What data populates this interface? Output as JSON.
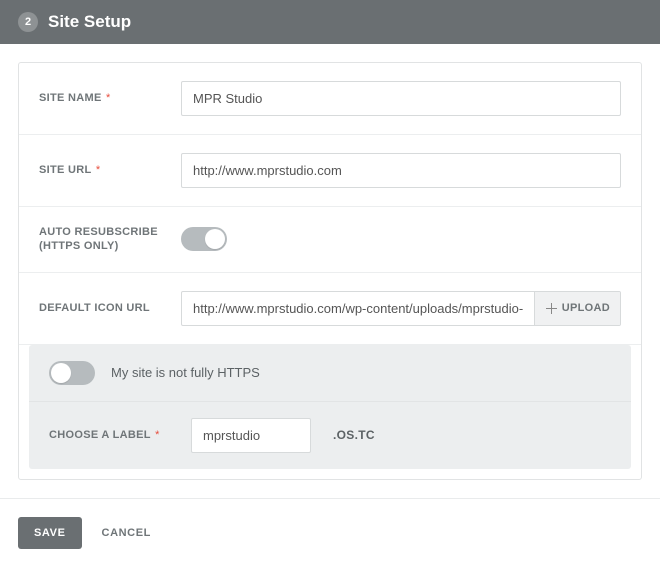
{
  "header": {
    "step": "2",
    "title": "Site Setup"
  },
  "form": {
    "site_name": {
      "label": "SITE NAME",
      "value": "MPR Studio"
    },
    "site_url": {
      "label": "SITE URL",
      "value": "http://www.mprstudio.com"
    },
    "auto_resub": {
      "label": "AUTO RESUBSCRIBE (HTTPS ONLY)"
    },
    "icon_url": {
      "label": "DEFAULT ICON URL",
      "value": "http://www.mprstudio.com/wp-content/uploads/mprstudio-icon.p",
      "upload_label": "UPLOAD"
    },
    "https_toggle": {
      "text": "My site is not fully HTTPS"
    },
    "choose_label": {
      "label": "CHOOSE A LABEL",
      "value": "mprstudio",
      "suffix": ".OS.TC"
    }
  },
  "footer": {
    "save_label": "SAVE",
    "cancel_label": "CANCEL"
  }
}
